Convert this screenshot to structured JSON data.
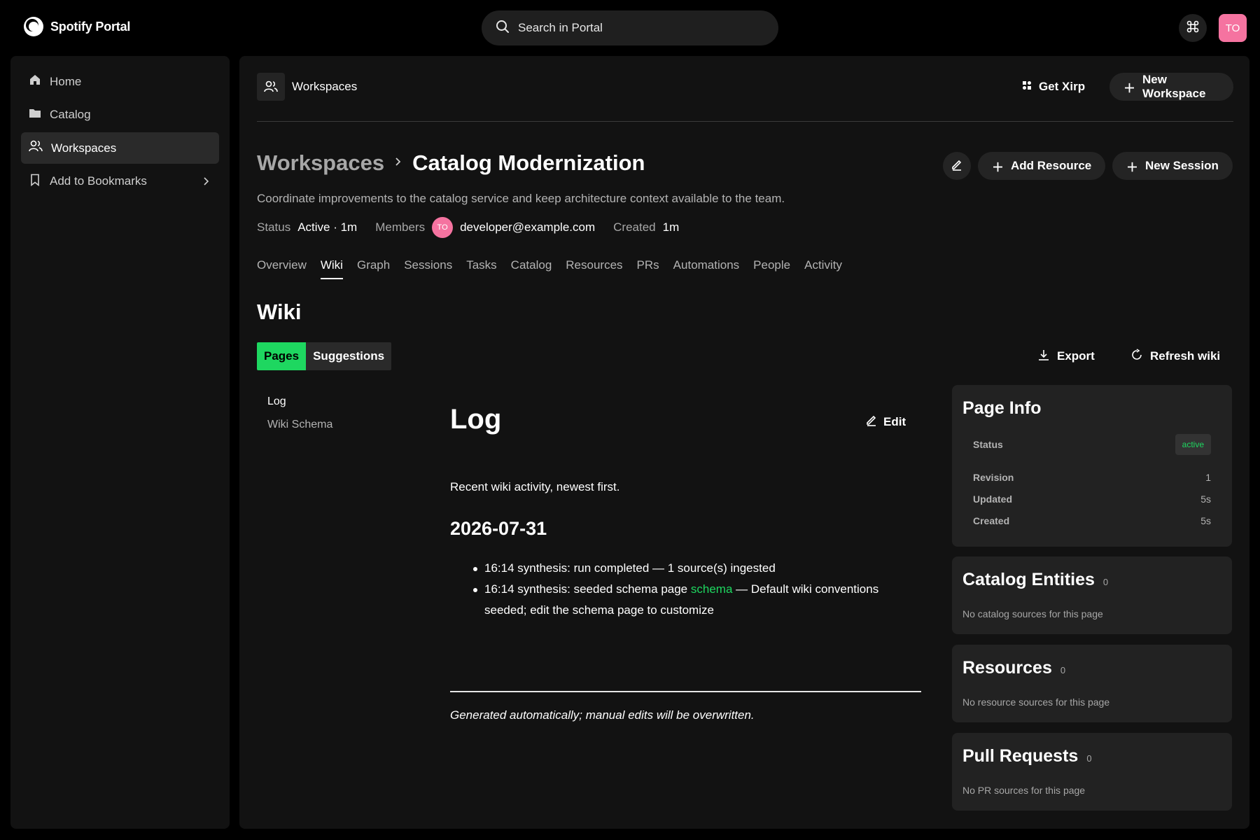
{
  "brand": {
    "name": "Spotify Portal"
  },
  "search": {
    "placeholder": "Search in Portal"
  },
  "user": {
    "initials": "TO"
  },
  "sidebar": {
    "items": [
      {
        "label": "Home",
        "icon": "home-icon"
      },
      {
        "label": "Catalog",
        "icon": "folder-icon"
      },
      {
        "label": "Workspaces",
        "icon": "people-icon"
      },
      {
        "label": "Add to Bookmarks",
        "icon": "bookmark-icon"
      }
    ]
  },
  "header": {
    "title": "Workspaces",
    "get_xirp": "Get Xirp",
    "new_workspace": "New Workspace"
  },
  "workspace": {
    "breadcrumb_parent": "Workspaces",
    "name": "Catalog Modernization",
    "add_resource": "Add Resource",
    "new_session": "New Session",
    "description": "Coordinate improvements to the catalog service and keep architecture context available to the team.",
    "status_label": "Status",
    "status_value": "Active · 1m",
    "members_label": "Members",
    "member_email": "developer@example.com",
    "created_label": "Created",
    "created_value": "1m"
  },
  "tabs": [
    "Overview",
    "Wiki",
    "Graph",
    "Sessions",
    "Tasks",
    "Catalog",
    "Resources",
    "PRs",
    "Automations",
    "People",
    "Activity"
  ],
  "wiki": {
    "heading": "Wiki",
    "seg_pages": "Pages",
    "seg_suggestions": "Suggestions",
    "export": "Export",
    "refresh": "Refresh wiki",
    "pages": [
      "Log",
      "Wiki Schema"
    ]
  },
  "article": {
    "title": "Log",
    "edit": "Edit",
    "intro": "Recent wiki activity, newest first.",
    "date": "2026-07-31",
    "entry1": "16:14 synthesis: run completed — 1 source(s) ingested",
    "entry2_pre": "16:14 synthesis: seeded schema page ",
    "entry2_link": "schema",
    "entry2_post": " — Default wiki conventions seeded; edit the schema page to customize",
    "footer": "Generated automatically; manual edits will be overwritten."
  },
  "page_info": {
    "title": "Page Info",
    "status_label": "Status",
    "status_value": "active",
    "revision_label": "Revision",
    "revision_value": "1",
    "updated_label": "Updated",
    "updated_value": "5s",
    "created_label": "Created",
    "created_value": "5s"
  },
  "catalog_entities": {
    "title": "Catalog Entities",
    "count": "0",
    "empty": "No catalog sources for this page"
  },
  "resources": {
    "title": "Resources",
    "count": "0",
    "empty": "No resource sources for this page"
  },
  "pull_requests": {
    "title": "Pull Requests",
    "count": "0",
    "empty": "No PR sources for this page"
  },
  "colors": {
    "accent": "#1ed760",
    "avatar": "#f573a0",
    "surface": "#121212",
    "card": "#222222"
  }
}
